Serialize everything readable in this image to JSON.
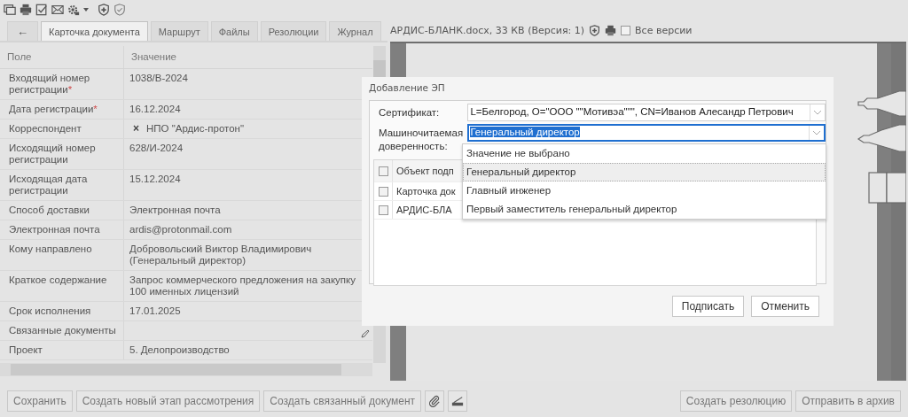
{
  "tabs_back": {
    "glyph": "←"
  },
  "tabs": [
    {
      "label": "Карточка документа",
      "selected": true
    },
    {
      "label": "Маршрут",
      "selected": false
    },
    {
      "label": "Файлы",
      "selected": false
    },
    {
      "label": "Резолюции",
      "selected": false
    },
    {
      "label": "Журнал",
      "selected": false
    }
  ],
  "document": {
    "file_label": "АРДИС-БЛАНК.docx, 33 КВ (Версия: 1)",
    "all_versions": {
      "label": "Все версии",
      "checked": false
    }
  },
  "table": {
    "columns": [
      "Поле",
      "Значение"
    ],
    "rows": [
      {
        "field": "Входящий номер регистрации",
        "mark": "*",
        "kind": "text",
        "value": "1038/В-2024"
      },
      {
        "field": "Дата регистрации",
        "mark": "*",
        "kind": "text",
        "value": "16.12.2024"
      },
      {
        "field": "Корреспондент",
        "kind": "tag",
        "glyph": "×",
        "value": "НПО \"Ардис-протон\""
      },
      {
        "field": "Исходящий номер регистрации",
        "kind": "text",
        "value": "628/И-2024"
      },
      {
        "field": "Исходящая дата регистрации",
        "kind": "text",
        "value": "15.12.2024"
      },
      {
        "field": "Способ доставки",
        "kind": "text",
        "value": "Электронная почта"
      },
      {
        "field": "Электронная почта",
        "kind": "text",
        "value": "ardis@protonmail.com"
      },
      {
        "field": "Кому направлено",
        "kind": "text",
        "value": "Добровольский Виктор Владимирович (Генеральный директор)"
      },
      {
        "field": "Краткое содержание",
        "kind": "text",
        "value": "Запрос коммерческого предложения на закупку 100 именных лицензий"
      },
      {
        "field": "Срок исполнения",
        "kind": "text",
        "value": "17.01.2025"
      },
      {
        "field": "Связанные документы",
        "kind": "edit"
      },
      {
        "field": "Проект",
        "kind": "text",
        "value": "5. Делопроизводство"
      }
    ]
  },
  "dialog": {
    "title": "Добавление ЭП",
    "certificate": {
      "label": "Сертификат:",
      "value": "L=Белгород, O=\"ООО \"\"Мотивэа\"\"\", CN=Иванов Алесандр Петрович"
    },
    "proxy": {
      "label": "Машиночитаемая доверенность:",
      "value": "Генеральный директор",
      "options": [
        {
          "label": "Значение не выбрано",
          "selected": false
        },
        {
          "label": "Генеральный директор",
          "selected": true
        },
        {
          "label": "Главный инженер",
          "selected": false
        },
        {
          "label": "Первый заместитель генеральный директор",
          "selected": false
        }
      ]
    },
    "objects": [
      {
        "label": "Объект подп",
        "checked": false,
        "kind": "header"
      },
      {
        "label": "Карточка док",
        "checked": false,
        "kind": "row"
      },
      {
        "label": "АРДИС-БЛА",
        "checked": false,
        "kind": "row"
      }
    ],
    "buttons": [
      "Подписать",
      "Отменить"
    ]
  },
  "bottom": {
    "left_buttons": [
      "Сохранить",
      "Создать новый этап рассмотрения",
      "Создать связанный документ"
    ],
    "right_buttons": [
      "Создать резолюцию",
      "Отправить в архив"
    ]
  }
}
